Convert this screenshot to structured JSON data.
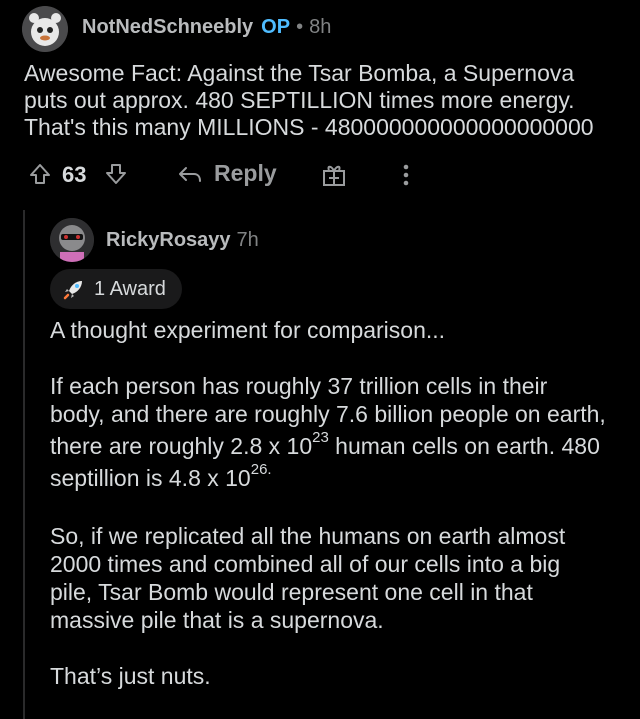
{
  "parent": {
    "username": "NotNedSchneebly",
    "op_badge": "OP",
    "separator": "•",
    "time": "8h",
    "body_lines": [
      "Awesome Fact: Against the Tsar Bomba, a Supernova",
      "puts out approx. 480 SEPTILLION times more energy.",
      "That's this many MILLIONS - 480000000000000000000"
    ],
    "score": "63",
    "reply_label": "Reply"
  },
  "reply": {
    "username": "RickyRosayy",
    "time": "7h",
    "award_label": "1 Award",
    "para1": "A thought experiment for comparison...",
    "para2": {
      "line1": "If each person has roughly 37 trillion cells in their",
      "line2": "body, and there are roughly 7.6 billion people on earth,",
      "line3_pre": "there are roughly 2.8 x 10",
      "line3_exp": "23",
      "line3_post": " human cells on earth. 480",
      "line4_pre": "septillion is 4.8 x 10",
      "line4_exp": "26."
    },
    "para3_lines": [
      "So, if we replicated all the humans on earth almost",
      "2000 times and combined all of our cells into a big",
      "pile, Tsar Bomb would represent one cell in that",
      "massive pile that is a supernova."
    ],
    "para4": "That’s just nuts."
  },
  "icons": {
    "upvote": "arrow-up-icon",
    "downvote": "arrow-down-icon",
    "reply": "reply-arrow-icon",
    "award": "gift-icon",
    "more": "more-vertical-icon",
    "award_badge": "rocket-icon"
  },
  "colors": {
    "background": "#000000",
    "text": "#d7dadc",
    "op": "#4fbcff",
    "muted": "#818384"
  }
}
